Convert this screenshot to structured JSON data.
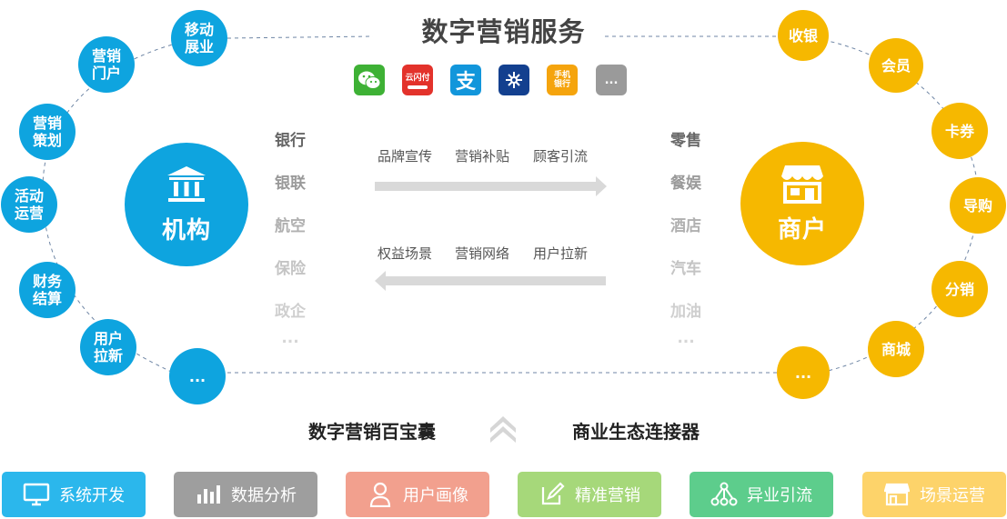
{
  "title": "数字营销服务",
  "pay_icons": [
    {
      "name": "wechat-pay-icon",
      "color": "#3eb135"
    },
    {
      "name": "unionpay-cloud-icon",
      "color": "#e3322b",
      "text": "云闪付"
    },
    {
      "name": "alipay-icon",
      "color": "#1296db",
      "text": "支"
    },
    {
      "name": "bank-network-icon",
      "color": "#13408f"
    },
    {
      "name": "mobile-bank-icon",
      "color": "#f5a40d",
      "text": "手机\n银行"
    },
    {
      "name": "more-icon",
      "color": "#9a9a9a",
      "text": "..."
    }
  ],
  "left_hub": {
    "label": "机构",
    "color": "#0ea4df"
  },
  "right_hub": {
    "label": "商户",
    "color": "#f6b800"
  },
  "left_nodes": [
    "移动\n展业",
    "营销\n门户",
    "营销\n策划",
    "活动\n运营",
    "财务\n结算",
    "用户\n拉新",
    "..."
  ],
  "right_nodes": [
    "收银",
    "会员",
    "卡券",
    "导购",
    "分销",
    "商城",
    "..."
  ],
  "left_list": [
    "银行",
    "银联",
    "航空",
    "保险",
    "政企",
    "..."
  ],
  "right_list": [
    "零售",
    "餐娱",
    "酒店",
    "汽车",
    "加油",
    "..."
  ],
  "arrow_top_labels": [
    "品牌宣传",
    "营销补贴",
    "顾客引流"
  ],
  "arrow_bottom_labels": [
    "权益场景",
    "营销网络",
    "用户拉新"
  ],
  "bottom_left_title": "数字营销百宝囊",
  "bottom_right_title": "商业生态连接器",
  "buttons": [
    {
      "label": "系统开发",
      "icon": "monitor-icon",
      "color": "#2bb7ec"
    },
    {
      "label": "数据分析",
      "icon": "bar-chart-icon",
      "color": "#9e9e9e"
    },
    {
      "label": "用户画像",
      "icon": "user-icon",
      "color": "#f2a08e"
    },
    {
      "label": "精准营销",
      "icon": "edit-icon",
      "color": "#a6d87a"
    },
    {
      "label": "异业引流",
      "icon": "network-icon",
      "color": "#5dcd8c"
    },
    {
      "label": "场景运营",
      "icon": "store-icon",
      "color": "#fdd36a"
    }
  ]
}
